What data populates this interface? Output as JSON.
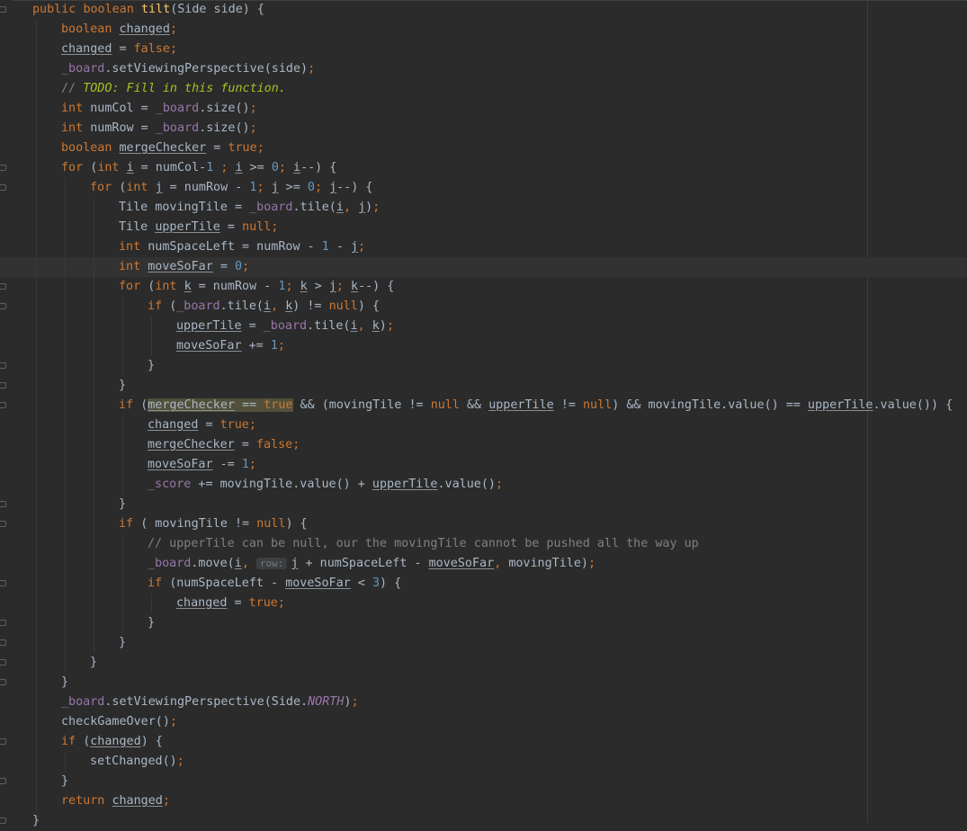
{
  "lines": [
    {
      "indent": 0,
      "fold": true,
      "current": false,
      "t": [
        [
          "kw",
          "public "
        ],
        [
          "kw",
          "boolean "
        ],
        [
          "fn",
          "tilt"
        ],
        [
          "",
          "(Side side) {"
        ]
      ]
    },
    {
      "indent": 1,
      "fold": false,
      "current": false,
      "t": [
        [
          "kw",
          "boolean "
        ],
        [
          "u",
          "changed"
        ],
        [
          "kw",
          ";"
        ]
      ]
    },
    {
      "indent": 1,
      "fold": false,
      "current": false,
      "t": [
        [
          "u",
          "changed"
        ],
        [
          "",
          " = "
        ],
        [
          "kw",
          "false"
        ],
        [
          "kw",
          ";"
        ]
      ]
    },
    {
      "indent": 1,
      "fold": false,
      "current": false,
      "t": [
        [
          "field",
          "_board"
        ],
        [
          "",
          ".setViewingPerspective(side)"
        ],
        [
          "kw",
          ";"
        ]
      ]
    },
    {
      "indent": 1,
      "fold": false,
      "current": false,
      "t": [
        [
          "cmt",
          "// "
        ],
        [
          "todo",
          "TODO: Fill in this function."
        ]
      ]
    },
    {
      "indent": 1,
      "fold": false,
      "current": false,
      "t": [
        [
          "kw",
          "int "
        ],
        [
          "",
          "numCol = "
        ],
        [
          "field",
          "_board"
        ],
        [
          "",
          ".size()"
        ],
        [
          "kw",
          ";"
        ]
      ]
    },
    {
      "indent": 1,
      "fold": false,
      "current": false,
      "t": [
        [
          "kw",
          "int "
        ],
        [
          "",
          "numRow = "
        ],
        [
          "field",
          "_board"
        ],
        [
          "",
          ".size()"
        ],
        [
          "kw",
          ";"
        ]
      ]
    },
    {
      "indent": 1,
      "fold": false,
      "current": false,
      "t": [
        [
          "kw",
          "boolean "
        ],
        [
          "u",
          "mergeChecker"
        ],
        [
          "",
          " = "
        ],
        [
          "kw",
          "true"
        ],
        [
          "kw",
          ";"
        ]
      ]
    },
    {
      "indent": 1,
      "fold": true,
      "current": false,
      "t": [
        [
          "kw",
          "for "
        ],
        [
          "",
          "("
        ],
        [
          "kw",
          "int "
        ],
        [
          "u",
          "i"
        ],
        [
          "",
          " = numCol-"
        ],
        [
          "num",
          "1"
        ],
        [
          "",
          " "
        ],
        [
          "kw",
          "; "
        ],
        [
          "u",
          "i"
        ],
        [
          "",
          " >= "
        ],
        [
          "num",
          "0"
        ],
        [
          "kw",
          "; "
        ],
        [
          "u",
          "i"
        ],
        [
          "",
          "--) {"
        ]
      ]
    },
    {
      "indent": 2,
      "fold": true,
      "current": false,
      "t": [
        [
          "kw",
          "for "
        ],
        [
          "",
          "("
        ],
        [
          "kw",
          "int "
        ],
        [
          "u",
          "j"
        ],
        [
          "",
          " = numRow - "
        ],
        [
          "num",
          "1"
        ],
        [
          "kw",
          "; "
        ],
        [
          "u",
          "j"
        ],
        [
          "",
          " >= "
        ],
        [
          "num",
          "0"
        ],
        [
          "kw",
          "; "
        ],
        [
          "u",
          "j"
        ],
        [
          "",
          "--) {"
        ]
      ]
    },
    {
      "indent": 3,
      "fold": false,
      "current": false,
      "t": [
        [
          "",
          "Tile movingTile = "
        ],
        [
          "field",
          "_board"
        ],
        [
          "",
          ".tile("
        ],
        [
          "u",
          "i"
        ],
        [
          "kw",
          ", "
        ],
        [
          "u",
          "j"
        ],
        [
          "",
          ")"
        ],
        [
          "kw",
          ";"
        ]
      ]
    },
    {
      "indent": 3,
      "fold": false,
      "current": false,
      "t": [
        [
          "",
          "Tile "
        ],
        [
          "u",
          "upperTile"
        ],
        [
          "",
          " = "
        ],
        [
          "kw",
          "null"
        ],
        [
          "kw",
          ";"
        ]
      ]
    },
    {
      "indent": 3,
      "fold": false,
      "current": false,
      "t": [
        [
          "kw",
          "int "
        ],
        [
          "",
          "numSpaceLeft = numRow - "
        ],
        [
          "num",
          "1"
        ],
        [
          "",
          " - "
        ],
        [
          "u",
          "j"
        ],
        [
          "kw",
          ";"
        ]
      ]
    },
    {
      "indent": 3,
      "fold": false,
      "current": true,
      "t": [
        [
          "kw",
          "int "
        ],
        [
          "u",
          "moveSoFar"
        ],
        [
          "",
          " = "
        ],
        [
          "num",
          "0"
        ],
        [
          "kw",
          ";"
        ]
      ]
    },
    {
      "indent": 3,
      "fold": true,
      "current": false,
      "t": [
        [
          "kw",
          "for "
        ],
        [
          "",
          "("
        ],
        [
          "kw",
          "int "
        ],
        [
          "u",
          "k"
        ],
        [
          "",
          " = numRow - "
        ],
        [
          "num",
          "1"
        ],
        [
          "kw",
          "; "
        ],
        [
          "u",
          "k"
        ],
        [
          "",
          " > "
        ],
        [
          "u",
          "j"
        ],
        [
          "kw",
          "; "
        ],
        [
          "u",
          "k"
        ],
        [
          "",
          "--) {"
        ]
      ]
    },
    {
      "indent": 4,
      "fold": true,
      "current": false,
      "t": [
        [
          "kw",
          "if "
        ],
        [
          "",
          "("
        ],
        [
          "field",
          "_board"
        ],
        [
          "",
          ".tile("
        ],
        [
          "u",
          "i"
        ],
        [
          "kw",
          ", "
        ],
        [
          "u",
          "k"
        ],
        [
          "",
          ") != "
        ],
        [
          "kw",
          "null"
        ],
        [
          "",
          ") {"
        ]
      ]
    },
    {
      "indent": 5,
      "fold": false,
      "current": false,
      "t": [
        [
          "u",
          "upperTile"
        ],
        [
          "",
          " = "
        ],
        [
          "field",
          "_board"
        ],
        [
          "",
          ".tile("
        ],
        [
          "u",
          "i"
        ],
        [
          "kw",
          ", "
        ],
        [
          "u",
          "k"
        ],
        [
          "",
          ")"
        ],
        [
          "kw",
          ";"
        ]
      ]
    },
    {
      "indent": 5,
      "fold": false,
      "current": false,
      "t": [
        [
          "u",
          "moveSoFar"
        ],
        [
          "",
          " += "
        ],
        [
          "num",
          "1"
        ],
        [
          "kw",
          ";"
        ]
      ]
    },
    {
      "indent": 4,
      "fold": true,
      "current": false,
      "t": [
        [
          "",
          "}"
        ]
      ]
    },
    {
      "indent": 3,
      "fold": true,
      "current": false,
      "t": [
        [
          "",
          "}"
        ]
      ]
    },
    {
      "indent": 3,
      "fold": true,
      "current": false,
      "t": [
        [
          "kw",
          "if "
        ],
        [
          "",
          "("
        ],
        [
          "uh",
          "mergeChecker"
        ],
        [
          "h",
          " == "
        ],
        [
          "kwh",
          "true"
        ],
        [
          "",
          " && (movingTile != "
        ],
        [
          "kw",
          "null"
        ],
        [
          "",
          " && "
        ],
        [
          "u",
          "upperTile"
        ],
        [
          "",
          " != "
        ],
        [
          "kw",
          "null"
        ],
        [
          "",
          ") && movingTile.value() == "
        ],
        [
          "u",
          "upperTile"
        ],
        [
          "",
          ".value()) {"
        ]
      ]
    },
    {
      "indent": 4,
      "fold": false,
      "current": false,
      "t": [
        [
          "u",
          "changed"
        ],
        [
          "",
          " = "
        ],
        [
          "kw",
          "true"
        ],
        [
          "kw",
          ";"
        ]
      ]
    },
    {
      "indent": 4,
      "fold": false,
      "current": false,
      "t": [
        [
          "u",
          "mergeChecker"
        ],
        [
          "",
          " = "
        ],
        [
          "kw",
          "false"
        ],
        [
          "kw",
          ";"
        ]
      ]
    },
    {
      "indent": 4,
      "fold": false,
      "current": false,
      "t": [
        [
          "u",
          "moveSoFar"
        ],
        [
          "",
          " -= "
        ],
        [
          "num",
          "1"
        ],
        [
          "kw",
          ";"
        ]
      ]
    },
    {
      "indent": 4,
      "fold": false,
      "current": false,
      "t": [
        [
          "field",
          "_score"
        ],
        [
          "",
          " += movingTile.value() + "
        ],
        [
          "u",
          "upperTile"
        ],
        [
          "",
          ".value()"
        ],
        [
          "kw",
          ";"
        ]
      ]
    },
    {
      "indent": 3,
      "fold": true,
      "current": false,
      "t": [
        [
          "",
          "}"
        ]
      ]
    },
    {
      "indent": 3,
      "fold": true,
      "current": false,
      "t": [
        [
          "kw",
          "if "
        ],
        [
          "",
          "( movingTile != "
        ],
        [
          "kw",
          "null"
        ],
        [
          "",
          ") {"
        ]
      ]
    },
    {
      "indent": 4,
      "fold": false,
      "current": false,
      "t": [
        [
          "cmt",
          "// upperTile can be null, our the movingTile cannot be pushed all the way up"
        ]
      ]
    },
    {
      "indent": 4,
      "fold": false,
      "current": false,
      "t": [
        [
          "field",
          "_board"
        ],
        [
          "",
          ".move("
        ],
        [
          "u",
          "i"
        ],
        [
          "kw",
          ", "
        ],
        [
          "hint",
          "row:"
        ],
        [
          "u",
          "j"
        ],
        [
          "",
          " + numSpaceLeft - "
        ],
        [
          "u",
          "moveSoFar"
        ],
        [
          "kw",
          ", "
        ],
        [
          "",
          "movingTile)"
        ],
        [
          "kw",
          ";"
        ]
      ]
    },
    {
      "indent": 4,
      "fold": true,
      "current": false,
      "t": [
        [
          "kw",
          "if "
        ],
        [
          "",
          "(numSpaceLeft - "
        ],
        [
          "u",
          "moveSoFar"
        ],
        [
          "",
          " < "
        ],
        [
          "num",
          "3"
        ],
        [
          "",
          ") {"
        ]
      ]
    },
    {
      "indent": 5,
      "fold": false,
      "current": false,
      "t": [
        [
          "u",
          "changed"
        ],
        [
          "",
          " = "
        ],
        [
          "kw",
          "true"
        ],
        [
          "kw",
          ";"
        ]
      ]
    },
    {
      "indent": 4,
      "fold": true,
      "current": false,
      "t": [
        [
          "",
          "}"
        ]
      ]
    },
    {
      "indent": 3,
      "fold": true,
      "current": false,
      "t": [
        [
          "",
          "}"
        ]
      ]
    },
    {
      "indent": 2,
      "fold": true,
      "current": false,
      "t": [
        [
          "",
          "}"
        ]
      ]
    },
    {
      "indent": 1,
      "fold": true,
      "current": false,
      "t": [
        [
          "",
          "}"
        ]
      ]
    },
    {
      "indent": 1,
      "fold": false,
      "current": false,
      "t": [
        [
          "field",
          "_board"
        ],
        [
          "",
          ".setViewingPerspective(Side."
        ],
        [
          "enum",
          "NORTH"
        ],
        [
          "",
          ")"
        ],
        [
          "kw",
          ";"
        ]
      ]
    },
    {
      "indent": 1,
      "fold": false,
      "current": false,
      "t": [
        [
          "",
          "checkGameOver()"
        ],
        [
          "kw",
          ";"
        ]
      ]
    },
    {
      "indent": 1,
      "fold": true,
      "current": false,
      "t": [
        [
          "kw",
          "if "
        ],
        [
          "",
          "("
        ],
        [
          "u",
          "changed"
        ],
        [
          "",
          ") {"
        ]
      ]
    },
    {
      "indent": 2,
      "fold": false,
      "current": false,
      "t": [
        [
          "",
          "setChanged()"
        ],
        [
          "kw",
          ";"
        ]
      ]
    },
    {
      "indent": 1,
      "fold": true,
      "current": false,
      "t": [
        [
          "",
          "}"
        ]
      ]
    },
    {
      "indent": 1,
      "fold": false,
      "current": false,
      "t": [
        [
          "kw",
          "return "
        ],
        [
          "u",
          "changed"
        ],
        [
          "kw",
          ";"
        ]
      ]
    },
    {
      "indent": 0,
      "fold": true,
      "current": false,
      "t": [
        [
          "",
          "}"
        ]
      ]
    }
  ]
}
